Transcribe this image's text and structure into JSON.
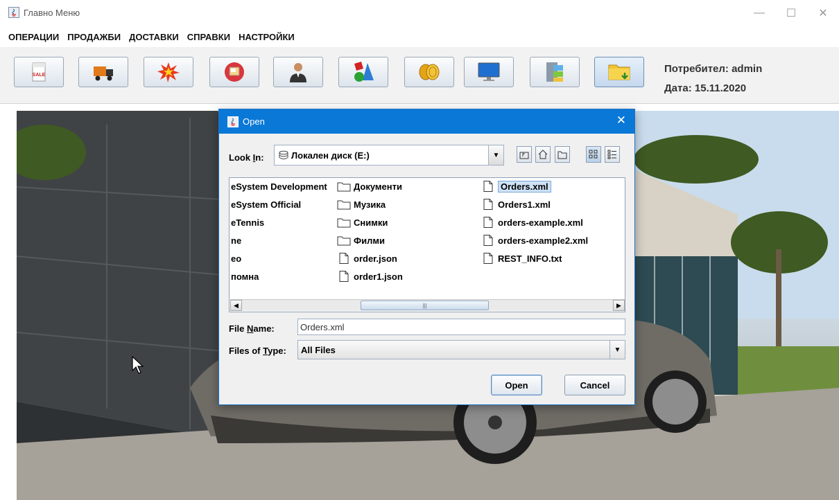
{
  "window": {
    "title": "Главно Меню",
    "controls": {
      "minimize": "—",
      "maximize": "☐",
      "close": "✕"
    }
  },
  "menubar": {
    "items": [
      "ОПЕРАЦИИ",
      "ПРОДАЖБИ",
      "ДОСТАВКИ",
      "СПРАВКИ",
      "НАСТРОЙКИ"
    ]
  },
  "toolbar": {
    "buttons": [
      {
        "icon": "sale-tag-icon"
      },
      {
        "icon": "delivery-truck-icon"
      },
      {
        "icon": "explosion-icon"
      },
      {
        "icon": "document-folder-icon"
      },
      {
        "icon": "user-person-icon"
      },
      {
        "icon": "shapes-icon"
      },
      {
        "icon": "coins-icon"
      },
      {
        "icon": "monitor-icon"
      },
      {
        "icon": "file-cabinet-icon"
      },
      {
        "icon": "folder-download-icon"
      }
    ]
  },
  "user_info": {
    "user": "Потребител: admin",
    "date": "Дата: 15.11.2020"
  },
  "dialog": {
    "title": "Open",
    "close": "✕",
    "look_in": {
      "label_pre": "Look ",
      "label_mnemonic": "I",
      "label_post": "n:",
      "value": "Локален диск (E:)"
    },
    "nav_buttons": [
      "up-one-level-icon",
      "home-icon",
      "new-folder-icon",
      "list-view-icon",
      "details-view-icon"
    ],
    "files": {
      "column1": [
        {
          "name": "eSystem Development",
          "icon": "none"
        },
        {
          "name": "eSystem Official",
          "icon": "none"
        },
        {
          "name": "eTennis",
          "icon": "none"
        },
        {
          "name": "ne",
          "icon": "none"
        },
        {
          "name": "eo",
          "icon": "none"
        },
        {
          "name": "помна",
          "icon": "none"
        }
      ],
      "column2": [
        {
          "name": "Документи",
          "icon": "folder-icon"
        },
        {
          "name": "Музика",
          "icon": "folder-icon"
        },
        {
          "name": "Снимки",
          "icon": "folder-icon"
        },
        {
          "name": "Филми",
          "icon": "folder-icon"
        },
        {
          "name": "order.json",
          "icon": "file-icon"
        },
        {
          "name": "order1.json",
          "icon": "file-icon"
        }
      ],
      "column3": [
        {
          "name": "Orders.xml",
          "icon": "file-icon",
          "selected": true
        },
        {
          "name": "Orders1.xml",
          "icon": "file-icon"
        },
        {
          "name": "orders-example.xml",
          "icon": "file-icon"
        },
        {
          "name": "orders-example2.xml",
          "icon": "file-icon"
        },
        {
          "name": "REST_INFO.txt",
          "icon": "file-icon"
        }
      ]
    },
    "scrollbar": {
      "left_arrow": "◀",
      "right_arrow": "▶",
      "grip": "|||"
    },
    "file_name": {
      "label_pre": "File ",
      "label_mnemonic": "N",
      "label_post": "ame:",
      "value": "Orders.xml"
    },
    "files_of_type": {
      "label_pre": "Files of ",
      "label_mnemonic": "T",
      "label_post": "ype:",
      "value": "All Files"
    },
    "combo_arrow": "▼",
    "open_button": "Open",
    "cancel_button": "Cancel"
  }
}
